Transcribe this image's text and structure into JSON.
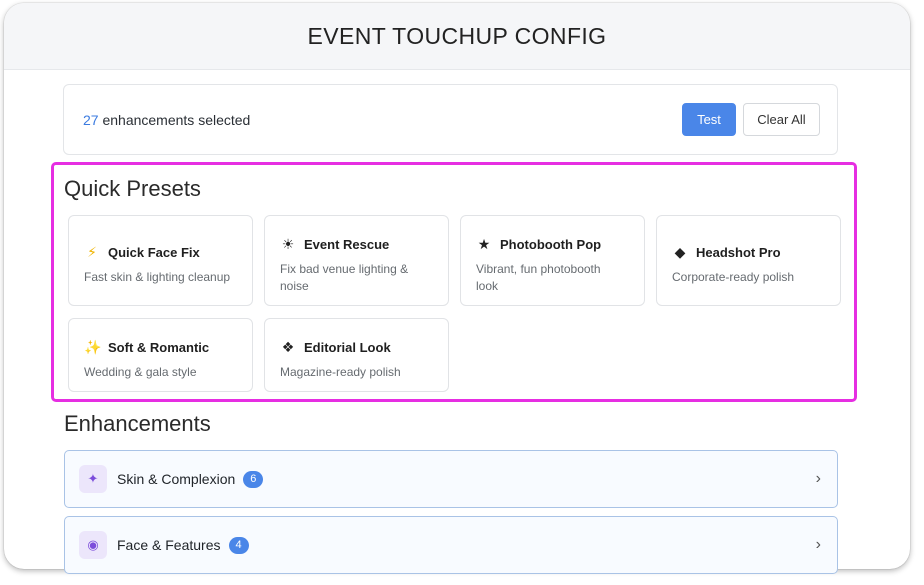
{
  "header": {
    "title": "EVENT TOUCHUP CONFIG"
  },
  "summary": {
    "count": "27",
    "text": " enhancements selected",
    "test_label": "Test",
    "clear_label": "Clear All"
  },
  "presets": {
    "title": "Quick Presets",
    "items": [
      {
        "icon": "⚡",
        "icon_name": "lightning-icon",
        "name": "Quick Face Fix",
        "desc": "Fast skin & lighting cleanup"
      },
      {
        "icon": "☀",
        "icon_name": "sun-icon",
        "name": "Event Rescue",
        "desc": "Fix bad venue lighting & noise"
      },
      {
        "icon": "★",
        "icon_name": "star-icon",
        "name": "Photobooth Pop",
        "desc": "Vibrant, fun photobooth look"
      },
      {
        "icon": "◆",
        "icon_name": "diamond-icon",
        "name": "Headshot Pro",
        "desc": "Corporate-ready polish"
      },
      {
        "icon": "✨",
        "icon_name": "sparkles-icon",
        "name": "Soft & Romantic",
        "desc": "Wedding & gala style"
      },
      {
        "icon": "❖",
        "icon_name": "four-diamonds-icon",
        "name": "Editorial Look",
        "desc": "Magazine-ready polish"
      }
    ]
  },
  "enhancements": {
    "title": "Enhancements",
    "groups": [
      {
        "icon": "✦",
        "icon_name": "sparkle-icon",
        "label": "Skin & Complexion",
        "count": "6"
      },
      {
        "icon": "◉",
        "icon_name": "face-target-icon",
        "label": "Face & Features",
        "count": "4"
      }
    ]
  },
  "colors": {
    "accent": "#4a86e8",
    "highlight": "#e62ee2",
    "accordion_border": "#a9c3e6"
  }
}
